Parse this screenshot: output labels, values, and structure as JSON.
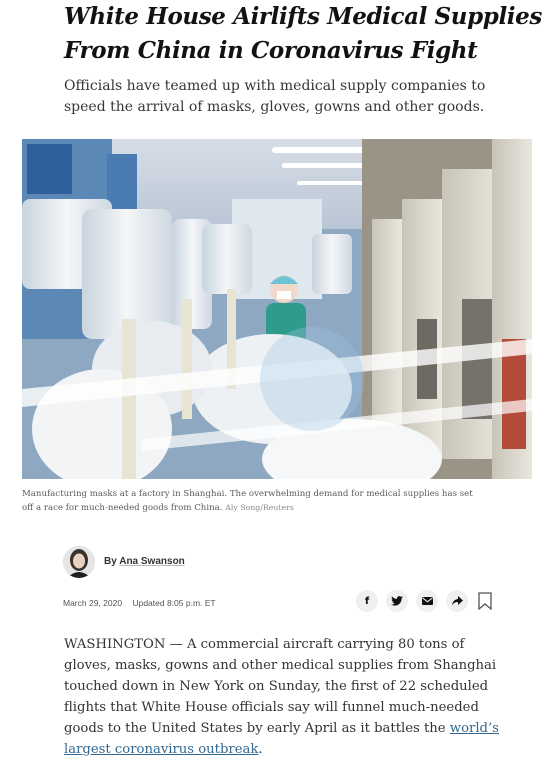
{
  "article": {
    "headline_lines": [
      "White House Airlifts Medical Supplies",
      "From China in Coronavirus Fight"
    ],
    "summary_lines": [
      "Officials have teamed up with medical supply companies to",
      "speed the arrival of masks, gloves, gowns and other goods."
    ],
    "caption_lines": [
      "Manufacturing masks at a factory in Shanghai. The overwhelming demand for medical supplies has set",
      "off a race for much-needed goods from China."
    ],
    "credit": "Aly Song/Reuters",
    "byline_prefix": "By",
    "author": "Ana Swanson",
    "published": "March 29, 2020",
    "updated": "Updated 8:05 p.m. ET",
    "body_lines": [
      "WASHINGTON — A commercial aircraft carrying 80 tons of",
      "gloves, masks, gowns and other medical supplies from Shanghai",
      "touched down in New York on Sunday, the first of 22 scheduled",
      "flights that White House officials say will funnel much-needed",
      "goods to the United States by early April as it battles the"
    ],
    "body_link_1": "world’s",
    "body_link_2": "largest coronavirus outbreak",
    "body_end": "."
  },
  "share": {
    "facebook": "f",
    "twitter_icon": "twitter-icon",
    "email_icon": "email-icon",
    "share_icon": "share-arrow-icon",
    "bookmark_icon": "bookmark-icon"
  },
  "colors": {
    "link": "#326891",
    "text": "#333333",
    "headline": "#121212"
  }
}
